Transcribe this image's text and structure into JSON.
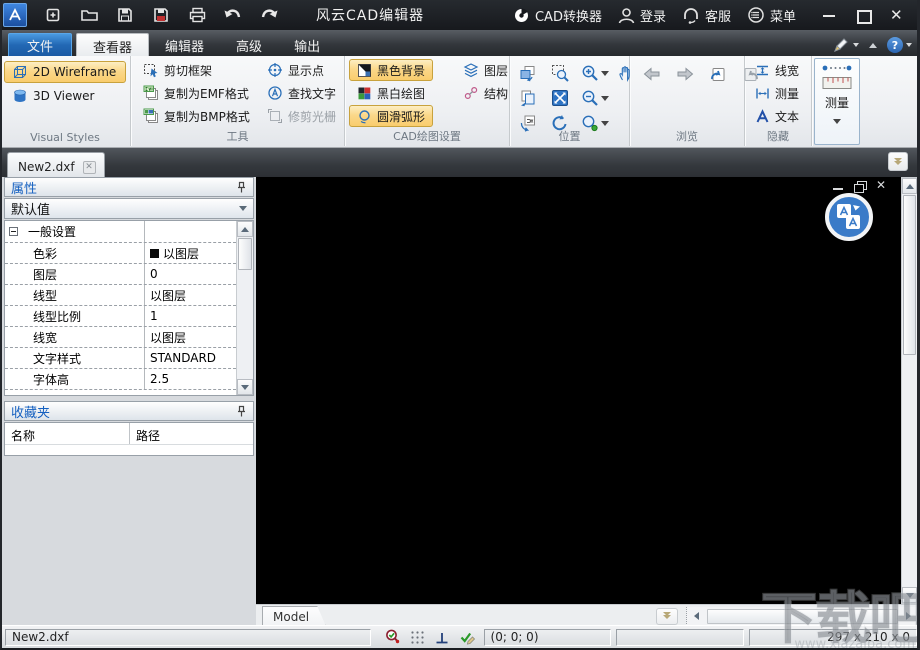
{
  "titlebar": {
    "title": "风云CAD编辑器",
    "converter_label": "CAD转换器",
    "login_label": "登录",
    "support_label": "客服",
    "menu_label": "菜单"
  },
  "ribbon_tabs": {
    "file": "文件",
    "viewer": "查看器",
    "editor": "编辑器",
    "advanced": "高级",
    "output": "输出"
  },
  "ribbon": {
    "visual_styles": {
      "label": "Visual Styles",
      "wireframe": "2D Wireframe",
      "viewer3d": "3D Viewer"
    },
    "tools": {
      "label": "工具",
      "cut_frame": "剪切框架",
      "copy_emf": "复制为EMF格式",
      "copy_bmp": "复制为BMP格式",
      "show_points": "显示点",
      "find_text": "查找文字",
      "trim_raster": "修剪光栅"
    },
    "cad_settings": {
      "label": "CAD绘图设置",
      "black_bg": "黑色背景",
      "bw_drawing": "黑白绘图",
      "smooth_arc": "圆滑弧形",
      "layers": "图层",
      "structure": "结构"
    },
    "position": {
      "label": "位置"
    },
    "browse": {
      "label": "浏览"
    },
    "hide": {
      "label": "隐藏",
      "line_width": "线宽",
      "measure": "测量",
      "text": "文本"
    },
    "measure_panel": {
      "label": "测量"
    }
  },
  "document": {
    "tab": "New2.dxf",
    "sheet_tab": "Model"
  },
  "properties": {
    "title": "属性",
    "preset": "默认值",
    "group_label": "一般设置",
    "rows": [
      {
        "label": "色彩",
        "value": "以图层"
      },
      {
        "label": "图层",
        "value": "0"
      },
      {
        "label": "线型",
        "value": "以图层"
      },
      {
        "label": "线型比例",
        "value": "1"
      },
      {
        "label": "线宽",
        "value": "以图层"
      },
      {
        "label": "文字样式",
        "value": "STANDARD"
      },
      {
        "label": "字体高",
        "value": "2.5"
      }
    ]
  },
  "favorites": {
    "title": "收藏夹",
    "col_name": "名称",
    "col_path": "路径"
  },
  "statusbar": {
    "filename": "New2.dxf",
    "coordinates": "(0; 0; 0)",
    "dimensions": "297 x 210 x 0"
  },
  "watermark": {
    "text": "下载吧",
    "site": "www.xiazaiba.com"
  },
  "colors": {
    "accent_blue": "#1560c0",
    "highlight_orange": "#fbd576",
    "titlebar_dark": "#1a1d21",
    "canvas": "#000000"
  }
}
